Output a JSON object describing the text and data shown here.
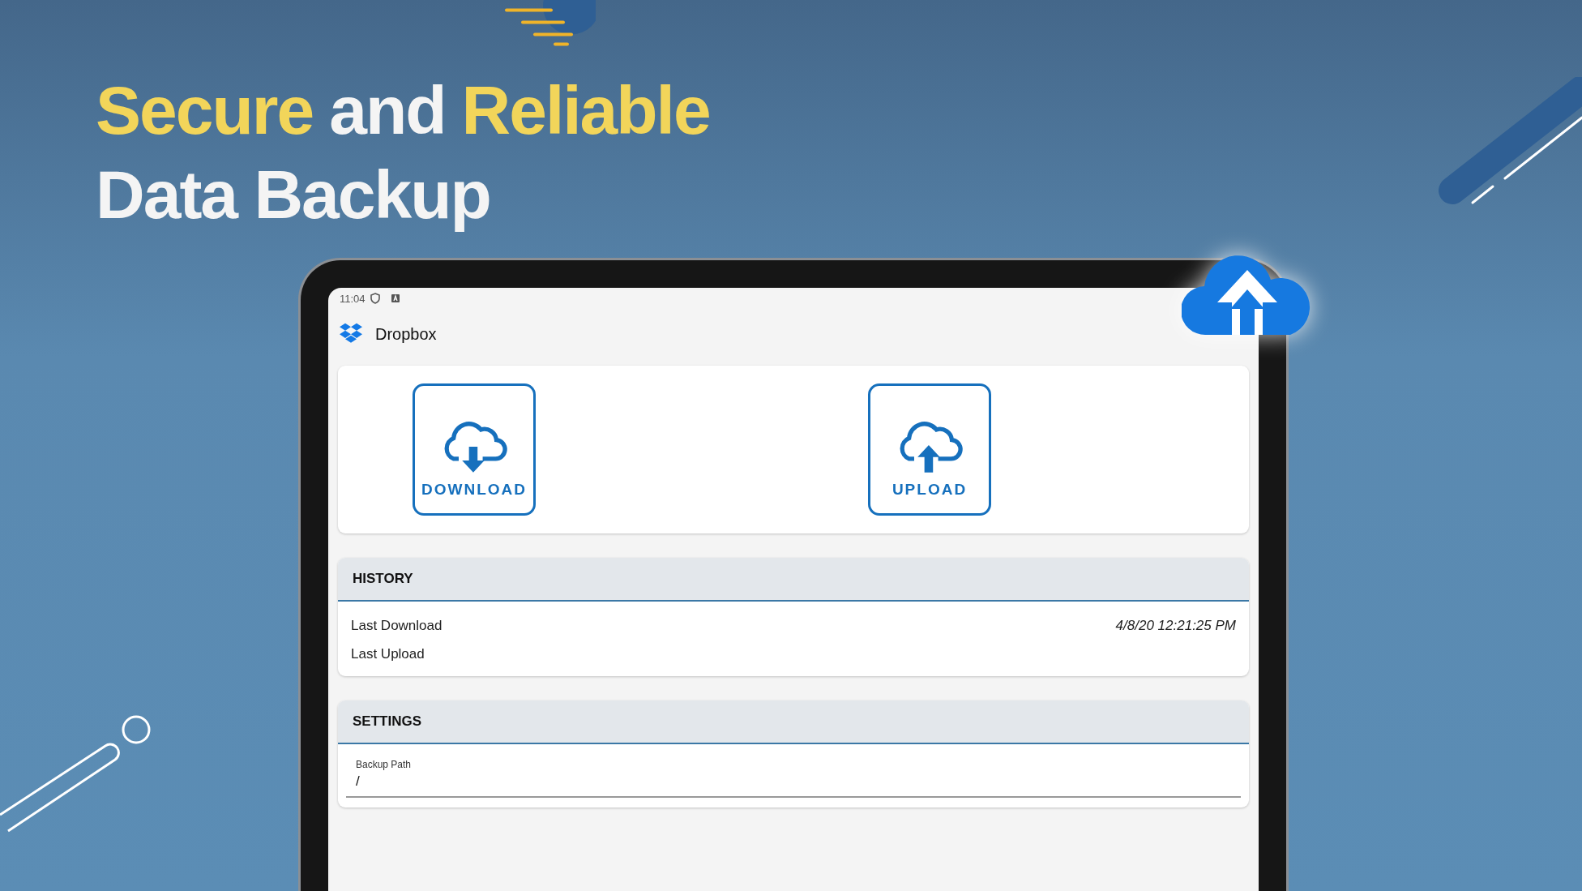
{
  "headline": {
    "lines": [
      {
        "words": [
          {
            "text": "Secure",
            "accent": true
          },
          {
            "text": "and",
            "accent": false
          },
          {
            "text": "Reliable",
            "accent": true
          }
        ]
      },
      {
        "words": [
          {
            "text": "Data Backup",
            "accent": false
          }
        ]
      }
    ]
  },
  "status_bar": {
    "time": "11:04"
  },
  "app_bar": {
    "title": "Dropbox"
  },
  "actions": [
    {
      "label": "DOWNLOAD",
      "kind": "download"
    },
    {
      "label": "UPLOAD",
      "kind": "upload"
    }
  ],
  "history": {
    "title": "HISTORY",
    "rows": [
      {
        "label": "Last Download",
        "value": "4/8/20 12:21:25 PM"
      },
      {
        "label": "Last Upload"
      }
    ]
  },
  "settings": {
    "title": "SETTINGS",
    "fields": [
      {
        "label": "Backup Path",
        "value": "/"
      }
    ]
  }
}
